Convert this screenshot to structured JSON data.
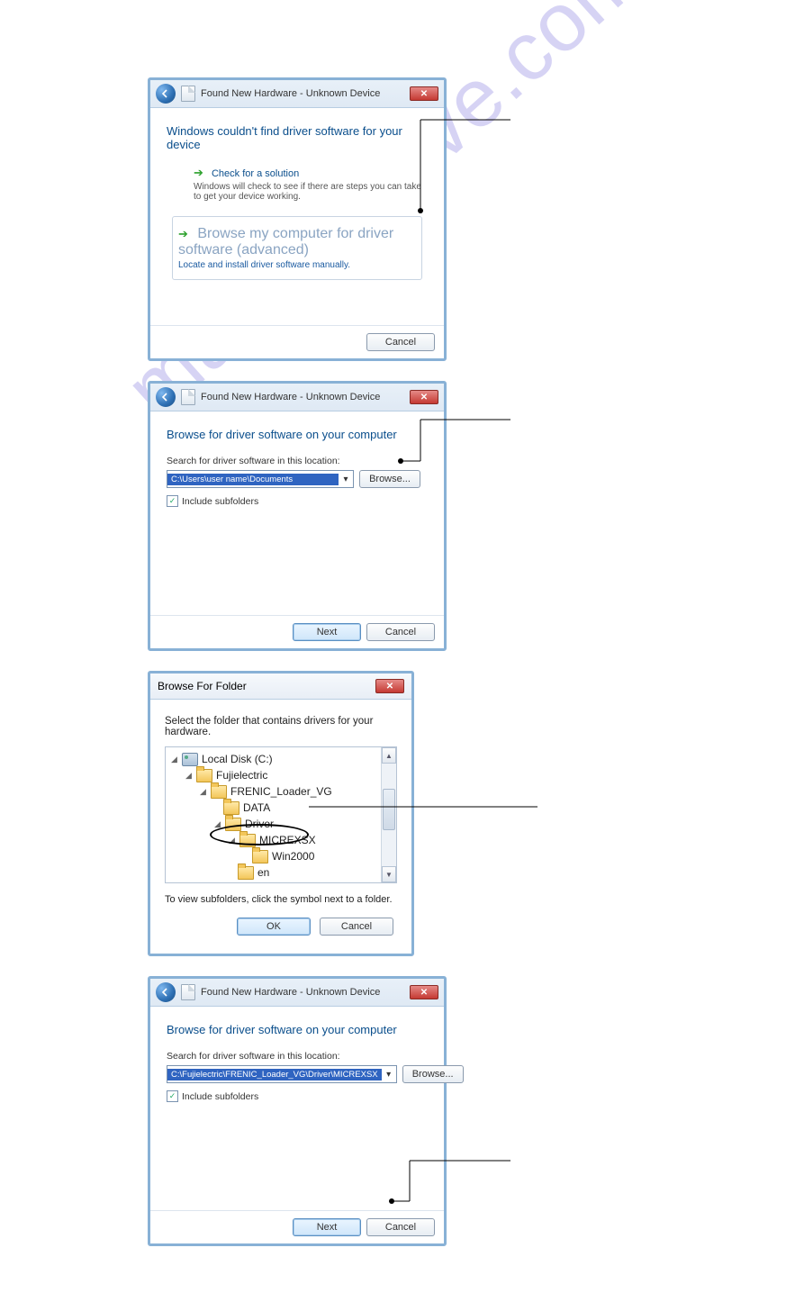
{
  "watermark": "manualshive.com",
  "dialog1": {
    "title": "Found New Hardware - Unknown Device",
    "heading": "Windows couldn't find driver software for your device",
    "option_a": {
      "title": "Check for a solution",
      "desc": "Windows will check to see if there are steps you can take to get your device working."
    },
    "option_b": {
      "title": "Browse my computer for driver software (advanced)",
      "desc": "Locate and install driver software manually."
    },
    "cancel": "Cancel"
  },
  "dialog2": {
    "title": "Found New Hardware - Unknown Device",
    "heading": "Browse for driver software on your computer",
    "search_label": "Search for driver software in this location:",
    "path": "C:\\Users\\user name\\Documents",
    "browse": "Browse...",
    "include": "Include subfolders",
    "next": "Next",
    "cancel": "Cancel"
  },
  "dialog3": {
    "title": "Browse For Folder",
    "instr": "Select the folder that contains drivers for your hardware.",
    "tree": {
      "n0": "Local Disk (C:)",
      "n1": "Fujielectric",
      "n2": "FRENIC_Loader_VG",
      "n3": "DATA",
      "n4": "Driver",
      "n5": "MICREXSX",
      "n6": "Win2000",
      "n7": "en"
    },
    "hint": "To view subfolders, click the symbol next to a folder.",
    "ok": "OK",
    "cancel": "Cancel"
  },
  "dialog4": {
    "title": "Found New Hardware - Unknown Device",
    "heading": "Browse for driver software on your computer",
    "search_label": "Search for driver software in this location:",
    "path": "C:\\Fujielectric\\FRENIC_Loader_VG\\Driver\\MICREXSX",
    "browse": "Browse...",
    "include": "Include subfolders",
    "next": "Next",
    "cancel": "Cancel"
  }
}
